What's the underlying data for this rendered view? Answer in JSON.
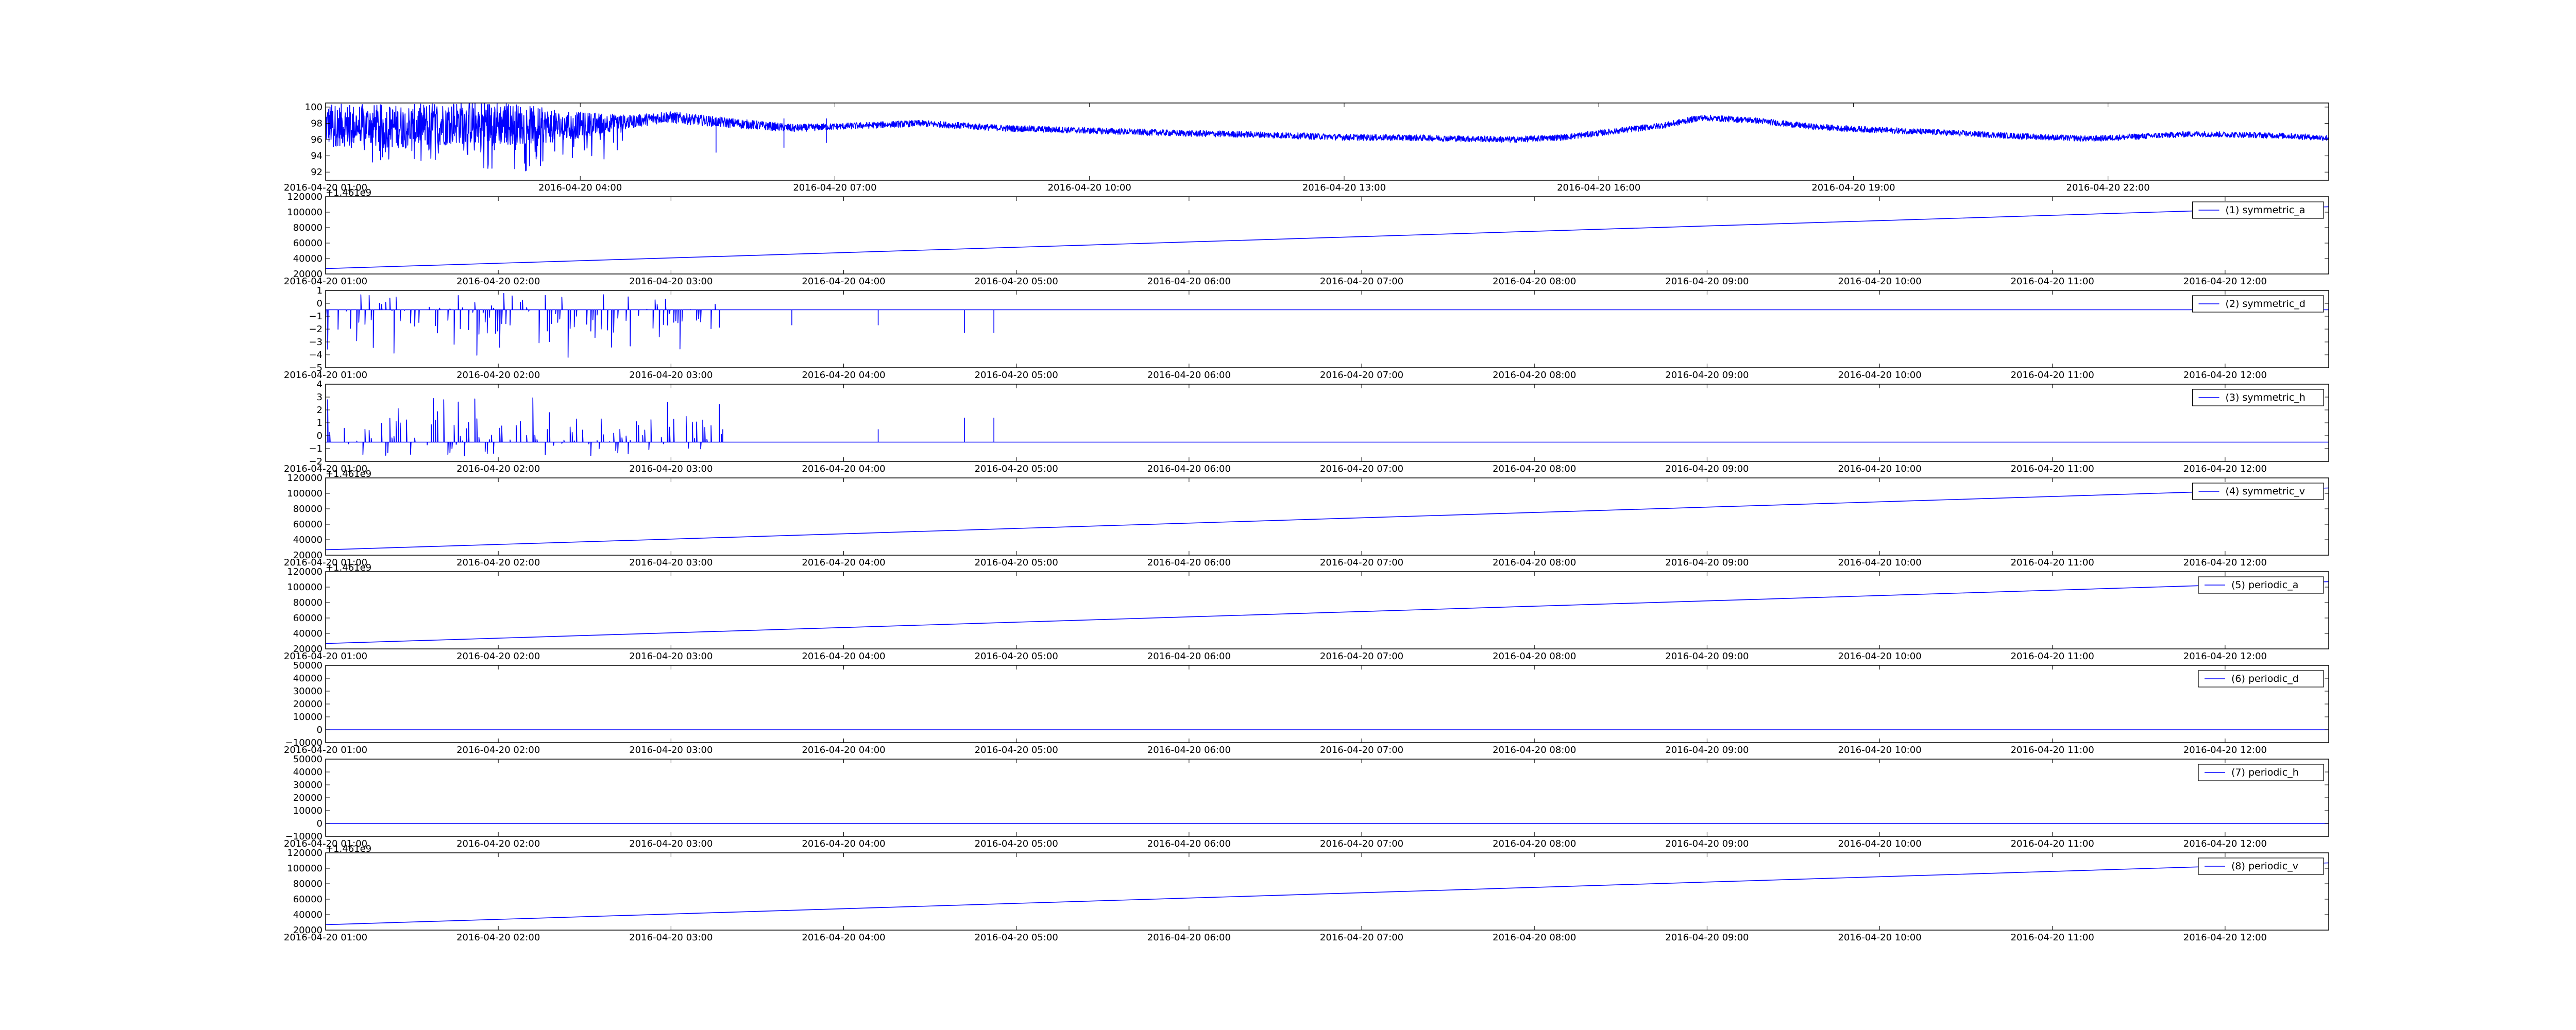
{
  "colors": {
    "line": "#0000ff",
    "axes": "#000000",
    "background": "#ffffff"
  },
  "chart_data": [
    {
      "type": "line",
      "name": "top-plot",
      "x_tick_labels": [
        "2016-04-20 01:00",
        "2016-04-20 04:00",
        "2016-04-20 07:00",
        "2016-04-20 10:00",
        "2016-04-20 13:00",
        "2016-04-20 16:00",
        "2016-04-20 19:00",
        "2016-04-20 22:00"
      ],
      "x_range_hours": [
        1.0,
        24.6
      ],
      "y_ticks": [
        92,
        94,
        96,
        98,
        100
      ],
      "ylim": [
        91,
        100.5
      ],
      "legend": null,
      "series": [
        {
          "x": [
            1.0,
            2.0,
            2.6,
            3.2,
            3.8,
            4.2,
            4.6,
            5.0,
            5.6,
            6.5,
            7.0,
            8.0,
            9.0,
            10.0,
            11.0,
            12.0,
            13.0,
            14.0,
            15.0,
            15.6,
            16.0,
            16.8,
            17.2,
            17.8,
            18.5,
            19.0,
            20.0,
            21.0,
            21.8,
            22.2,
            23.0,
            24.0,
            24.6
          ],
          "values": [
            97.8,
            97.6,
            98.2,
            97.9,
            97.6,
            98.0,
            98.2,
            98.8,
            98.2,
            97.4,
            97.6,
            98.0,
            97.4,
            97.1,
            96.8,
            96.6,
            96.3,
            96.2,
            96.0,
            96.3,
            96.8,
            97.8,
            98.7,
            98.4,
            97.6,
            97.3,
            96.9,
            96.4,
            96.1,
            96.3,
            96.7,
            96.5,
            96.2
          ],
          "noise_amplitude_by_hour": [
            [
              1.0,
              2.6
            ],
            [
              3.0,
              2.8
            ],
            [
              3.4,
              2.4
            ],
            [
              4.6,
              0.8
            ],
            [
              7.0,
              0.4
            ],
            [
              24.6,
              0.35
            ]
          ],
          "spikes_hours": [
            5.6,
            6.4,
            6.9
          ]
        }
      ]
    },
    {
      "type": "line",
      "x_tick_labels": [
        "2016-04-20 01:00",
        "2016-04-20 02:00",
        "2016-04-20 03:00",
        "2016-04-20 04:00",
        "2016-04-20 05:00",
        "2016-04-20 06:00",
        "2016-04-20 07:00",
        "2016-04-20 08:00",
        "2016-04-20 09:00",
        "2016-04-20 10:00",
        "2016-04-20 11:00",
        "2016-04-20 12:00"
      ],
      "x_range_hours": [
        1.0,
        12.6
      ],
      "y_ticks": [
        20000,
        40000,
        60000,
        80000,
        100000,
        120000
      ],
      "ylim": [
        20000,
        120000
      ],
      "offset_text": "+1.461e9",
      "legend": "(1) symmetric_a",
      "series": [
        {
          "name": "(1) symmetric_a",
          "x": [
            1.0,
            12.6
          ],
          "values": [
            27000,
            107000
          ]
        }
      ]
    },
    {
      "type": "line",
      "x_tick_labels": [
        "2016-04-20 01:00",
        "2016-04-20 02:00",
        "2016-04-20 03:00",
        "2016-04-20 04:00",
        "2016-04-20 05:00",
        "2016-04-20 06:00",
        "2016-04-20 07:00",
        "2016-04-20 08:00",
        "2016-04-20 09:00",
        "2016-04-20 10:00",
        "2016-04-20 11:00",
        "2016-04-20 12:00"
      ],
      "x_range_hours": [
        1.0,
        12.6
      ],
      "y_ticks": [
        1,
        0,
        -1,
        -2,
        -3,
        -4,
        -5
      ],
      "ylim": [
        -5,
        1
      ],
      "legend": "(2) symmetric_d",
      "series": [
        {
          "name": "(2) symmetric_d",
          "baseline": -0.5,
          "spike_direction": "down",
          "spike_range": [
            -4.2,
            0.8
          ],
          "dense_until_hour": 3.3,
          "sparse_spikes_hours": [
            3.7,
            4.2,
            4.7,
            4.87
          ]
        }
      ]
    },
    {
      "type": "line",
      "x_tick_labels": [
        "2016-04-20 01:00",
        "2016-04-20 02:00",
        "2016-04-20 03:00",
        "2016-04-20 04:00",
        "2016-04-20 05:00",
        "2016-04-20 06:00",
        "2016-04-20 07:00",
        "2016-04-20 08:00",
        "2016-04-20 09:00",
        "2016-04-20 10:00",
        "2016-04-20 11:00",
        "2016-04-20 12:00"
      ],
      "x_range_hours": [
        1.0,
        12.6
      ],
      "y_ticks": [
        4,
        3,
        2,
        1,
        0,
        -1,
        -2
      ],
      "ylim": [
        -2,
        4
      ],
      "legend": "(3) symmetric_h",
      "series": [
        {
          "name": "(3) symmetric_h",
          "baseline": -0.5,
          "spike_direction": "up",
          "spike_range": [
            -1.6,
            3.0
          ],
          "dense_until_hour": 3.3,
          "sparse_spikes_hours": [
            3.3,
            4.2,
            4.7,
            4.87
          ]
        }
      ]
    },
    {
      "type": "line",
      "x_tick_labels": [
        "2016-04-20 01:00",
        "2016-04-20 02:00",
        "2016-04-20 03:00",
        "2016-04-20 04:00",
        "2016-04-20 05:00",
        "2016-04-20 06:00",
        "2016-04-20 07:00",
        "2016-04-20 08:00",
        "2016-04-20 09:00",
        "2016-04-20 10:00",
        "2016-04-20 11:00",
        "2016-04-20 12:00"
      ],
      "x_range_hours": [
        1.0,
        12.6
      ],
      "y_ticks": [
        20000,
        40000,
        60000,
        80000,
        100000,
        120000
      ],
      "ylim": [
        20000,
        120000
      ],
      "offset_text": "+1.461e9",
      "legend": "(4) symmetric_v",
      "series": [
        {
          "name": "(4) symmetric_v",
          "x": [
            1.0,
            12.6
          ],
          "values": [
            27000,
            107000
          ]
        }
      ]
    },
    {
      "type": "line",
      "x_tick_labels": [
        "2016-04-20 01:00",
        "2016-04-20 02:00",
        "2016-04-20 03:00",
        "2016-04-20 04:00",
        "2016-04-20 05:00",
        "2016-04-20 06:00",
        "2016-04-20 07:00",
        "2016-04-20 08:00",
        "2016-04-20 09:00",
        "2016-04-20 10:00",
        "2016-04-20 11:00",
        "2016-04-20 12:00"
      ],
      "x_range_hours": [
        1.0,
        12.6
      ],
      "y_ticks": [
        20000,
        40000,
        60000,
        80000,
        100000,
        120000
      ],
      "ylim": [
        20000,
        120000
      ],
      "offset_text": "+1.461e9",
      "legend": "(5) periodic_a",
      "series": [
        {
          "name": "(5) periodic_a",
          "x": [
            1.0,
            12.6
          ],
          "values": [
            27000,
            107000
          ]
        }
      ]
    },
    {
      "type": "line",
      "x_tick_labels": [
        "2016-04-20 01:00",
        "2016-04-20 02:00",
        "2016-04-20 03:00",
        "2016-04-20 04:00",
        "2016-04-20 05:00",
        "2016-04-20 06:00",
        "2016-04-20 07:00",
        "2016-04-20 08:00",
        "2016-04-20 09:00",
        "2016-04-20 10:00",
        "2016-04-20 11:00",
        "2016-04-20 12:00"
      ],
      "x_range_hours": [
        1.0,
        12.6
      ],
      "y_ticks": [
        50000,
        40000,
        30000,
        20000,
        10000,
        0,
        -10000
      ],
      "ylim": [
        -10000,
        50000
      ],
      "legend": "(6) periodic_d",
      "series": [
        {
          "name": "(6) periodic_d",
          "x": [
            1.0,
            12.6
          ],
          "values": [
            0,
            0
          ]
        }
      ]
    },
    {
      "type": "line",
      "x_tick_labels": [
        "2016-04-20 01:00",
        "2016-04-20 02:00",
        "2016-04-20 03:00",
        "2016-04-20 04:00",
        "2016-04-20 05:00",
        "2016-04-20 06:00",
        "2016-04-20 07:00",
        "2016-04-20 08:00",
        "2016-04-20 09:00",
        "2016-04-20 10:00",
        "2016-04-20 11:00",
        "2016-04-20 12:00"
      ],
      "x_range_hours": [
        1.0,
        12.6
      ],
      "y_ticks": [
        50000,
        40000,
        30000,
        20000,
        10000,
        0,
        -10000
      ],
      "ylim": [
        -10000,
        50000
      ],
      "legend": "(7) periodic_h",
      "series": [
        {
          "name": "(7) periodic_h",
          "x": [
            1.0,
            12.6
          ],
          "values": [
            0,
            0
          ]
        }
      ]
    },
    {
      "type": "line",
      "x_tick_labels": [
        "2016-04-20 01:00",
        "2016-04-20 02:00",
        "2016-04-20 03:00",
        "2016-04-20 04:00",
        "2016-04-20 05:00",
        "2016-04-20 06:00",
        "2016-04-20 07:00",
        "2016-04-20 08:00",
        "2016-04-20 09:00",
        "2016-04-20 10:00",
        "2016-04-20 11:00",
        "2016-04-20 12:00"
      ],
      "x_range_hours": [
        1.0,
        12.6
      ],
      "y_ticks": [
        20000,
        40000,
        60000,
        80000,
        100000,
        120000
      ],
      "ylim": [
        20000,
        120000
      ],
      "offset_text": "+1.461e9",
      "legend": "(8) periodic_v",
      "series": [
        {
          "name": "(8) periodic_v",
          "x": [
            1.0,
            12.6
          ],
          "values": [
            27000,
            107000
          ]
        }
      ]
    }
  ]
}
